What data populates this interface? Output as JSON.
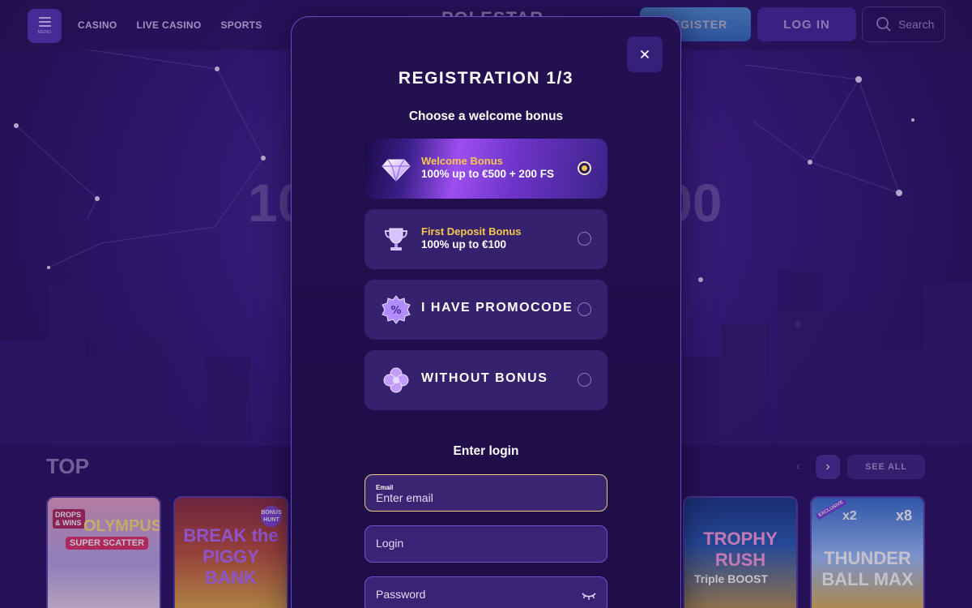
{
  "header": {
    "menu_label": "MENU",
    "nav": [
      "CASINO",
      "LIVE CASINO",
      "SPORTS"
    ],
    "logo": "POLESTAR",
    "register_label": "REGISTER",
    "login_label": "LOG IN",
    "search_label": "Search"
  },
  "hero": {
    "left_fragment": "10",
    "right_fragment": "00"
  },
  "top_section": {
    "title": "TOP",
    "see_all": "SEE ALL",
    "games": [
      {
        "tag": "DROPS & WINS",
        "title": "OLYMPUS",
        "subtitle": "SUPER SCATTER"
      },
      {
        "tag": "BONUS HUNT",
        "title": "BREAK the PIGGY BANK"
      },
      {
        "title": "TROPHY RUSH",
        "subtitle": "Triple BOOST"
      },
      {
        "tag": "EXCLUSIVE",
        "title": "THUNDER BALL MAX",
        "badges": [
          "x2",
          "x8"
        ]
      }
    ]
  },
  "modal": {
    "title": "REGISTRATION 1/3",
    "subtitle": "Choose a welcome bonus",
    "options": [
      {
        "name": "Welcome Bonus",
        "desc": "100% up to €500 + 200 FS",
        "icon": "diamond-icon",
        "selected": true
      },
      {
        "name": "First Deposit Bonus",
        "desc": "100% up to €100",
        "icon": "trophy-icon",
        "selected": false
      },
      {
        "label": "I HAVE PROMOCODE",
        "icon": "promo-badge-icon",
        "selected": false
      },
      {
        "label": "WITHOUT BONUS",
        "icon": "clover-icon",
        "selected": false
      }
    ],
    "login_heading": "Enter login",
    "email": {
      "label": "Email",
      "placeholder": "Enter email"
    },
    "login": {
      "placeholder": "Login"
    },
    "password": {
      "placeholder": "Password"
    }
  },
  "colors": {
    "accent_gold": "#f5c74b",
    "modal_bg": "#241051",
    "option_bg": "#36216f",
    "border": "#6a4cc8"
  }
}
